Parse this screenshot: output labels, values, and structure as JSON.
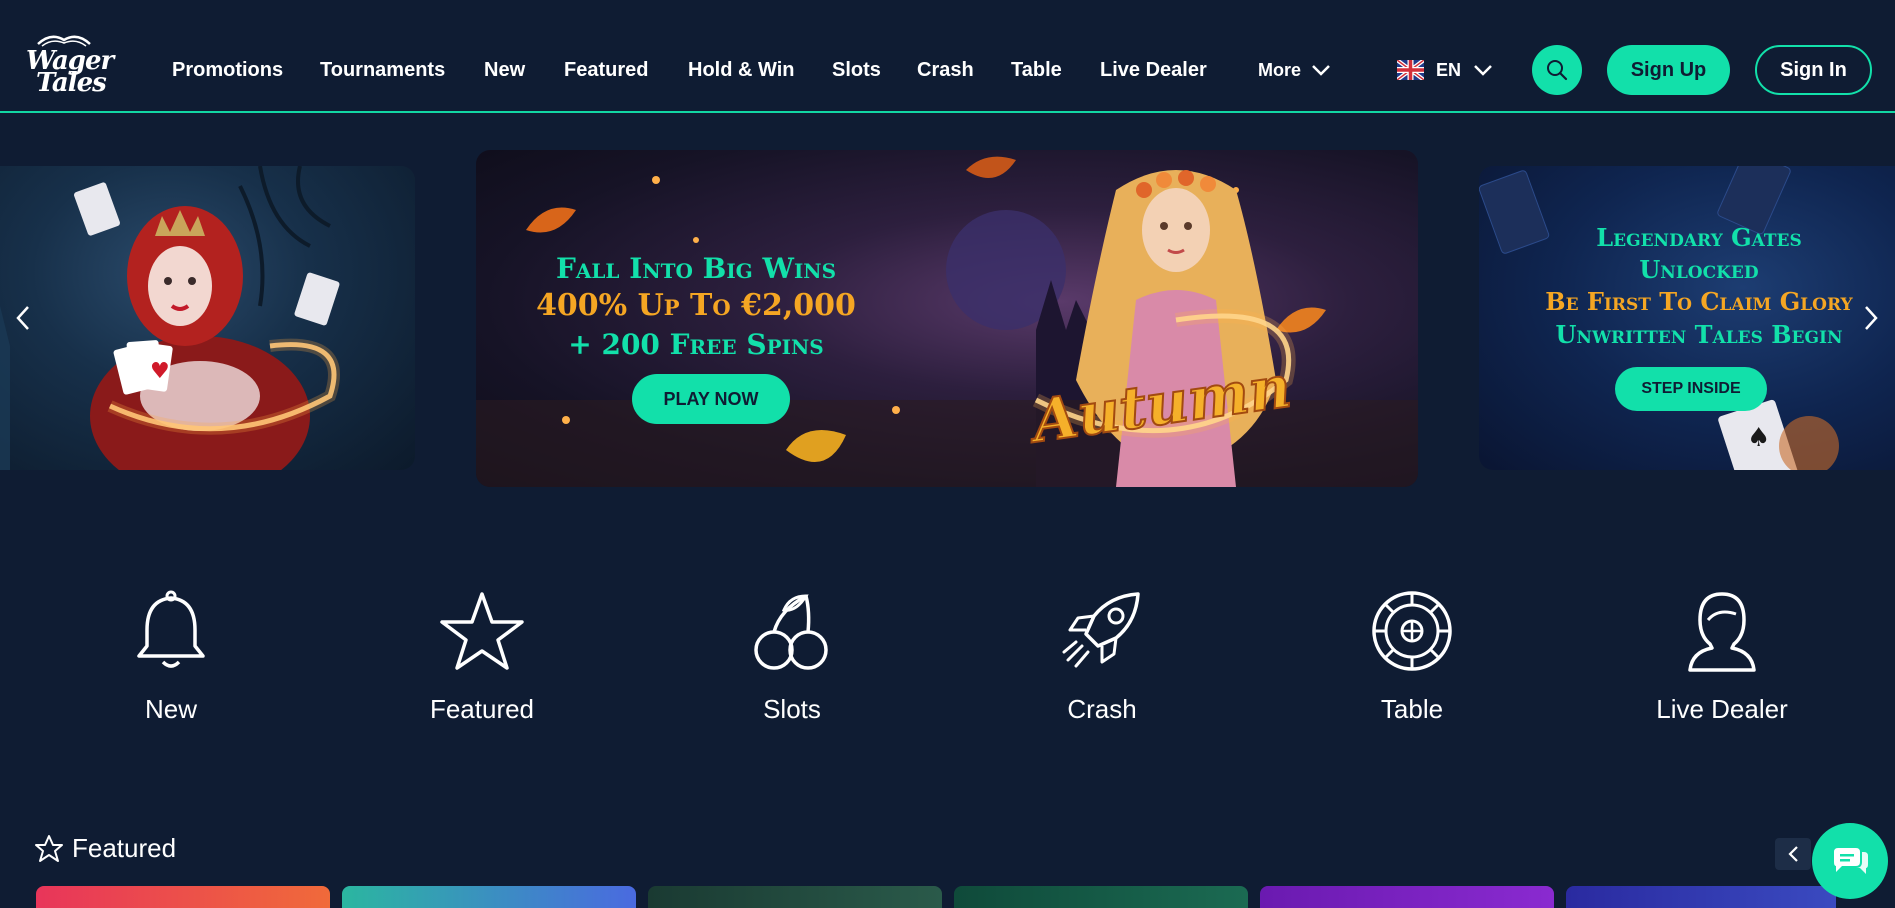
{
  "brand": {
    "logo_line1": "Wager",
    "logo_line2": "Tales"
  },
  "nav": [
    {
      "label": "Promotions"
    },
    {
      "label": "Tournaments"
    },
    {
      "label": "New"
    },
    {
      "label": "Featured"
    },
    {
      "label": "Hold & Win"
    },
    {
      "label": "Slots"
    },
    {
      "label": "Crash"
    },
    {
      "label": "Table"
    },
    {
      "label": "Live Dealer"
    }
  ],
  "header": {
    "more_label": "More",
    "lang_label": "EN",
    "signup_label": "Sign Up",
    "signin_label": "Sign In"
  },
  "slides": {
    "center": {
      "line1": "Fall Into Big Wins",
      "line2": "400% Up To €2,000",
      "line3": "+ 200 Free Spins",
      "cta": "PLAY NOW",
      "art_text": "Autumn"
    },
    "right": {
      "line1": "Legendary Gates",
      "line2": "Unlocked",
      "line3": "Be First To Claim Glory",
      "line4": "Unwritten Tales Begin",
      "cta": "STEP INSIDE"
    }
  },
  "categories": [
    {
      "label": "New",
      "icon": "bell-icon"
    },
    {
      "label": "Featured",
      "icon": "star-icon"
    },
    {
      "label": "Slots",
      "icon": "cherries-icon"
    },
    {
      "label": "Crash",
      "icon": "rocket-icon"
    },
    {
      "label": "Table",
      "icon": "roulette-icon"
    },
    {
      "label": "Live Dealer",
      "icon": "dealer-icon"
    }
  ],
  "featured": {
    "title": "Featured"
  },
  "colors": {
    "background": "#0f1c33",
    "accent": "#12e0aa",
    "gold": "#f5a623"
  }
}
